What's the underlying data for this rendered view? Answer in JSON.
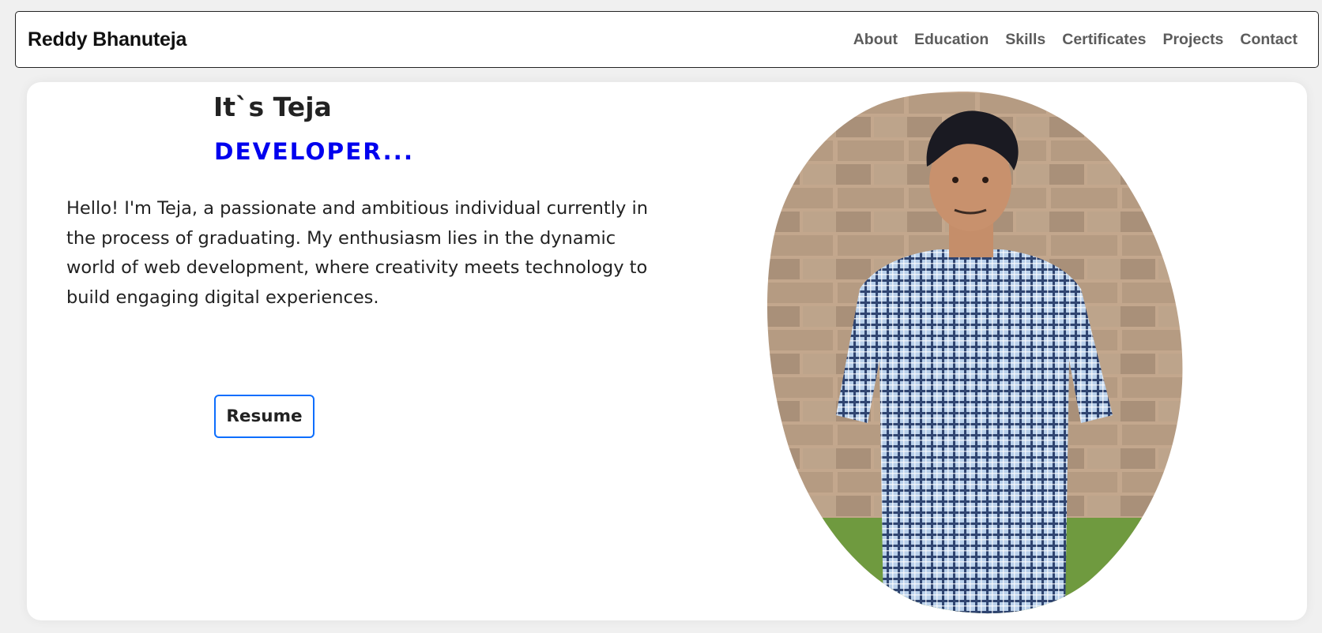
{
  "navbar": {
    "brand": "Reddy Bhanuteja",
    "links": [
      "About",
      "Education",
      "Skills",
      "Certificates",
      "Projects",
      "Contact"
    ]
  },
  "hero": {
    "greeting": "It`s Teja",
    "role": "DEVELOPER...",
    "intro": "Hello! I'm Teja, a passionate and ambitious individual currently in the process of graduating. My enthusiasm lies in the dynamic world of web development, where creativity meets technology to build engaging digital experiences.",
    "resume_label": "Resume",
    "photo": "profile-photo"
  },
  "colors": {
    "role_text": "#0000ee",
    "button_border": "#0d6efd",
    "nav_link": "#5c5c5c"
  }
}
